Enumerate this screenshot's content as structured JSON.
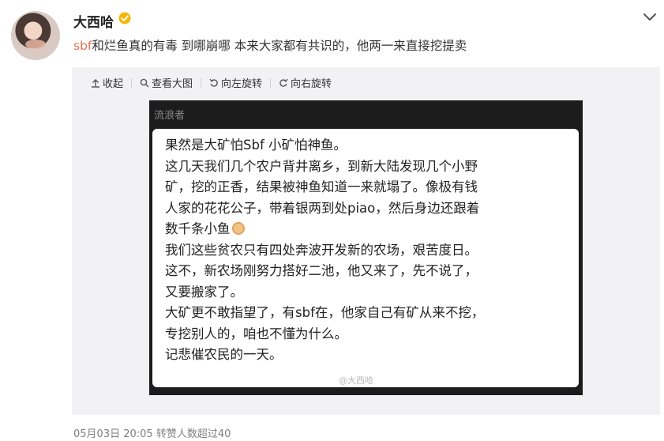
{
  "post": {
    "username": "大西哈",
    "text_tag": "sbf",
    "text_rest": "和烂鱼真的有毒 到哪崩哪 本来大家都有共识的，他两一来直接挖提卖",
    "meta": "05月03日 20:05 转赞人数超过40"
  },
  "toolbar": {
    "collapse": "收起",
    "view_large": "查看大图",
    "rotate_left": "向左旋转",
    "rotate_right": "向右旋转"
  },
  "image": {
    "header": "流浪者",
    "lines": [
      "果然是大矿怕Sbf 小矿怕神鱼。",
      "这几天我们几个农户背井离乡，到新大陆发现几个小野",
      "矿，挖的正香，结果被神鱼知道一来就塌了。像极有钱",
      "人家的花花公子，带着银两到处piao，然后身边还跟着",
      "数千条小鱼",
      "我们这些贫农只有四处奔波开发新的农场，艰苦度日。",
      "这不，新农场刚努力搭好二池，他又来了，先不说了，",
      "又要搬家了。",
      "大矿更不敢指望了，有sbf在，他家自己有矿从来不挖，",
      "专挖别人的，咱也不懂为什么。",
      "记悲催农民的一天。"
    ],
    "watermark": "@大西哈"
  },
  "icons": {
    "verified": "verified-badge-icon",
    "chevron": "chevron-down-icon",
    "collapse": "collapse-arrow-icon",
    "zoom": "magnifier-icon",
    "rotate_left": "rotate-left-icon",
    "rotate_right": "rotate-right-icon",
    "emoji": "emoji-icon"
  },
  "colors": {
    "tag": "#eb7350",
    "verified": "#f7b500",
    "media_bg": "#f2f2f5",
    "meta": "#808080"
  }
}
